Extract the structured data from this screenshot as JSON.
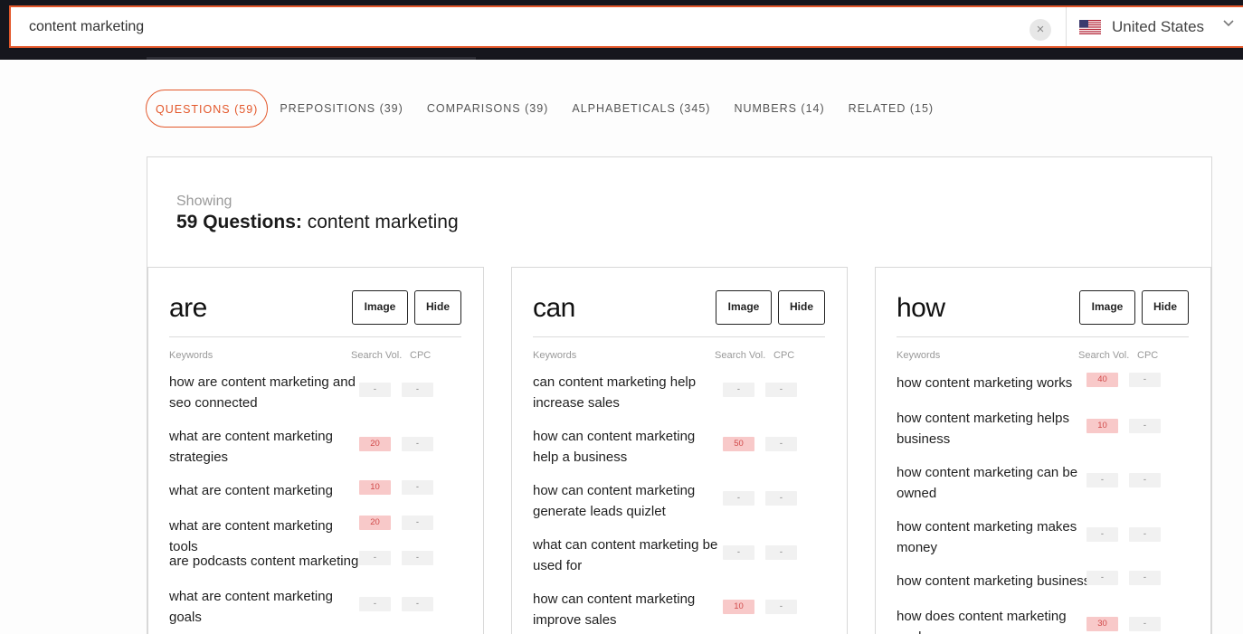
{
  "search": {
    "value": "content marketing",
    "clear_icon": "×"
  },
  "country": {
    "label": "United States",
    "flag": "us-flag-icon"
  },
  "tabs": [
    {
      "label": "QUESTIONS (59)",
      "active": true
    },
    {
      "label": "PREPOSITIONS (39)"
    },
    {
      "label": "COMPARISONS (39)"
    },
    {
      "label": "ALPHABETICALS (345)"
    },
    {
      "label": "NUMBERS (14)"
    },
    {
      "label": "RELATED (15)"
    }
  ],
  "results": {
    "showing_label": "Showing",
    "heading_bold": "59 Questions:",
    "heading_rest": " content marketing"
  },
  "columns": [
    {
      "title": "are",
      "image_label": "Image",
      "hide_label": "Hide",
      "headers": {
        "keywords": "Keywords",
        "volume": "Search Vol.",
        "cpc": "CPC"
      },
      "rows": [
        {
          "text": "how are content marketing and seo connected",
          "vol": "-",
          "cpc": "-"
        },
        {
          "text": "what are content marketing strategies",
          "vol": "20",
          "cpc": "-"
        },
        {
          "text": "what are content marketing",
          "vol": "10",
          "cpc": "-"
        },
        {
          "text": "what are content marketing tools",
          "vol": "20",
          "cpc": "-"
        },
        {
          "text": "are podcasts content marketing",
          "vol": "-",
          "cpc": "-"
        },
        {
          "text": "what are content marketing goals",
          "vol": "-",
          "cpc": "-"
        }
      ]
    },
    {
      "title": "can",
      "image_label": "Image",
      "hide_label": "Hide",
      "headers": {
        "keywords": "Keywords",
        "volume": "Search Vol.",
        "cpc": "CPC"
      },
      "rows": [
        {
          "text": "can content marketing help increase sales",
          "vol": "-",
          "cpc": "-"
        },
        {
          "text": "how can content marketing help a business",
          "vol": "50",
          "cpc": "-"
        },
        {
          "text": "how can content marketing generate leads quizlet",
          "vol": "-",
          "cpc": "-"
        },
        {
          "text": "what can content marketing be used for",
          "vol": "-",
          "cpc": "-"
        },
        {
          "text": "how can content marketing improve sales",
          "vol": "10",
          "cpc": "-"
        }
      ]
    },
    {
      "title": "how",
      "image_label": "Image",
      "hide_label": "Hide",
      "headers": {
        "keywords": "Keywords",
        "volume": "Search Vol.",
        "cpc": "CPC"
      },
      "rows": [
        {
          "text": "how content marketing works",
          "vol": "40",
          "cpc": "-"
        },
        {
          "text": "how content marketing helps business",
          "vol": "10",
          "cpc": "-"
        },
        {
          "text": "how content marketing can be owned",
          "vol": "-",
          "cpc": "-"
        },
        {
          "text": "how content marketing makes money",
          "vol": "-",
          "cpc": "-"
        },
        {
          "text": "how content marketing business",
          "vol": "-",
          "cpc": "-"
        },
        {
          "text": "how does content marketing work",
          "vol": "30",
          "cpc": "-"
        }
      ]
    }
  ]
}
